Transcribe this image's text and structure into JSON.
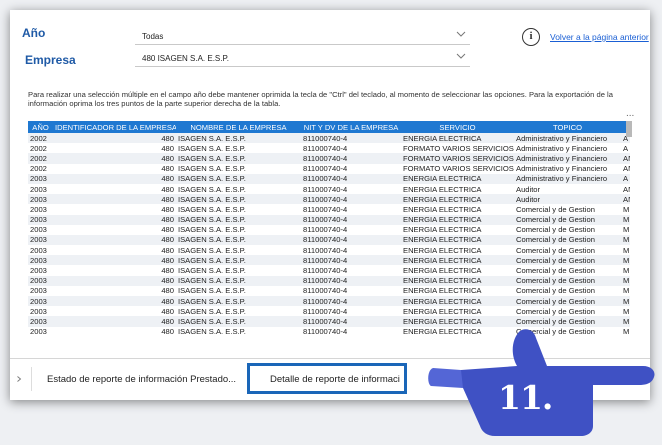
{
  "filters": {
    "year_label": "Año",
    "year_value": "Todas",
    "company_label": "Empresa",
    "company_value": "480 ISAGEN S.A. E.S.P."
  },
  "back_link": "Volver a la página anterior",
  "info_glyph": "i",
  "note": "Para realizar una selección múltiple en el campo año debe mantener oprimida la tecla de \"Ctrl\" del teclado, al momento de seleccionar las opciones. Para la exportación de la información oprima los tres puntos de la parte superior derecha de la tabla.",
  "more_glyph": "...",
  "table": {
    "columns": [
      "AÑO",
      "IDENTIFICADOR DE LA EMPRESA",
      "NOMBRE DE LA EMPRESA",
      "NIT Y DV DE LA EMPRESA",
      "SERVICIO",
      "TOPICO",
      "PE"
    ],
    "rows": [
      [
        "2002",
        "480",
        "ISAGEN S.A. E.S.P.",
        "811000740-4",
        "ENERGIA ELECTRICA",
        "Administrativo y Financiero",
        "A"
      ],
      [
        "2002",
        "480",
        "ISAGEN S.A. E.S.P.",
        "811000740-4",
        "FORMATO VARIOS SERVICIOS",
        "Administrativo y Financiero",
        "A"
      ],
      [
        "2002",
        "480",
        "ISAGEN S.A. E.S.P.",
        "811000740-4",
        "FORMATO VARIOS SERVICIOS",
        "Administrativo y Financiero",
        "ANU"
      ],
      [
        "2002",
        "480",
        "ISAGEN S.A. E.S.P.",
        "811000740-4",
        "FORMATO VARIOS SERVICIOS",
        "Administrativo y Financiero",
        "ANU"
      ],
      [
        "2003",
        "480",
        "ISAGEN S.A. E.S.P.",
        "811000740-4",
        "ENERGIA ELECTRICA",
        "Administrativo y Financiero",
        "A"
      ],
      [
        "2003",
        "480",
        "ISAGEN S.A. E.S.P.",
        "811000740-4",
        "ENERGIA ELECTRICA",
        "Auditor",
        "ANU"
      ],
      [
        "2003",
        "480",
        "ISAGEN S.A. E.S.P.",
        "811000740-4",
        "ENERGIA ELECTRICA",
        "Auditor",
        "ANU"
      ],
      [
        "2003",
        "480",
        "ISAGEN S.A. E.S.P.",
        "811000740-4",
        "ENERGIA ELECTRICA",
        "Comercial y de Gestion",
        "MES"
      ],
      [
        "2003",
        "480",
        "ISAGEN S.A. E.S.P.",
        "811000740-4",
        "ENERGIA ELECTRICA",
        "Comercial y de Gestion",
        "MES"
      ],
      [
        "2003",
        "480",
        "ISAGEN S.A. E.S.P.",
        "811000740-4",
        "ENERGIA ELECTRICA",
        "Comercial y de Gestion",
        "MES"
      ],
      [
        "2003",
        "480",
        "ISAGEN S.A. E.S.P.",
        "811000740-4",
        "ENERGIA ELECTRICA",
        "Comercial y de Gestion",
        "MES"
      ],
      [
        "2003",
        "480",
        "ISAGEN S.A. E.S.P.",
        "811000740-4",
        "ENERGIA ELECTRICA",
        "Comercial y de Gestion",
        "MES"
      ],
      [
        "2003",
        "480",
        "ISAGEN S.A. E.S.P.",
        "811000740-4",
        "ENERGIA ELECTRICA",
        "Comercial y de Gestion",
        "MES"
      ],
      [
        "2003",
        "480",
        "ISAGEN S.A. E.S.P.",
        "811000740-4",
        "ENERGIA ELECTRICA",
        "Comercial y de Gestion",
        "MES"
      ],
      [
        "2003",
        "480",
        "ISAGEN S.A. E.S.P.",
        "811000740-4",
        "ENERGIA ELECTRICA",
        "Comercial y de Gestion",
        "MES"
      ],
      [
        "2003",
        "480",
        "ISAGEN S.A. E.S.P.",
        "811000740-4",
        "ENERGIA ELECTRICA",
        "Comercial y de Gestion",
        "MES"
      ],
      [
        "2003",
        "480",
        "ISAGEN S.A. E.S.P.",
        "811000740-4",
        "ENERGIA ELECTRICA",
        "Comercial y de Gestion",
        "MES"
      ],
      [
        "2003",
        "480",
        "ISAGEN S.A. E.S.P.",
        "811000740-4",
        "ENERGIA ELECTRICA",
        "Comercial y de Gestion",
        "MES"
      ],
      [
        "2003",
        "480",
        "ISAGEN S.A. E.S.P.",
        "811000740-4",
        "ENERGIA ELECTRICA",
        "Comercial y de Gestion",
        "MES"
      ],
      [
        "2003",
        "480",
        "ISAGEN S.A. E.S.P.",
        "811000740-4",
        "ENERGIA ELECTRICA",
        "Comercial y de Gestion",
        "MES"
      ]
    ]
  },
  "tabs": [
    {
      "label": "Estado de reporte de información Prestado..."
    },
    {
      "label": "Detalle de reporte de informaci"
    }
  ],
  "callout": {
    "step": "11."
  },
  "colors": {
    "accent": "#1f78d1",
    "label": "#1f5aa6",
    "link": "#1a5fd4",
    "hand": "#3f51c4"
  }
}
